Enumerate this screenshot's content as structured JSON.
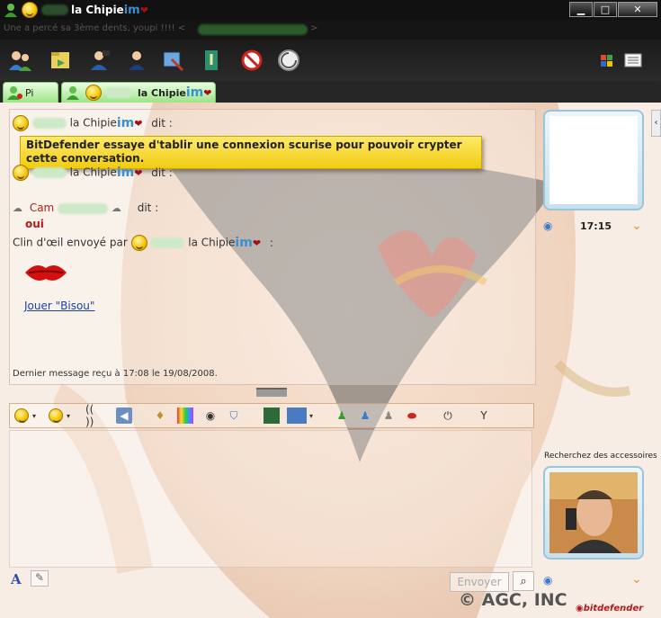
{
  "window": {
    "title_name": "la Chipie",
    "title_logo": "im",
    "personal_message": "Une a percé sa 3ème dents, youpi !!!! <",
    "personal_message_end": ">",
    "buttons": {
      "minimize": "▁",
      "maximize": "□",
      "close": "✕"
    }
  },
  "toolbar": {
    "icons": [
      "invite-contact-icon",
      "send-files-icon",
      "webcam-icon",
      "call-icon",
      "share-icon",
      "games-icon",
      "block-icon",
      "activities-icon"
    ]
  },
  "tabs": [
    {
      "label": "Pi"
    },
    {
      "label": "la Chipie",
      "logo": "im"
    }
  ],
  "notice": "BitDefender essaye d'tablir une connexion scurise pour pouvoir crypter cette conversation.",
  "conversation": {
    "msg1": {
      "name": "la Chipie",
      "logo": "im",
      "says": "dit :"
    },
    "msg2": {
      "name": "la Chipie",
      "logo": "im",
      "says": "dit :"
    },
    "msg3": {
      "name": "Cam",
      "says": "dit :",
      "text": "oui"
    },
    "wink": {
      "prefix": "Clin d'œil envoyé par",
      "name": "la Chipie",
      "logo": "im",
      "suffix": ":"
    },
    "play_link": "Jouer \"Bisou\"",
    "last_message": "Dernier message reçu à 17:08 le 19/08/2008."
  },
  "sidebar": {
    "time": "17:15",
    "accessories_label": "Recherchez des accessoires"
  },
  "input": {
    "send_label": "Envoyer"
  },
  "branding": {
    "copyright": "© AGC, INC",
    "bitdefender": "bitdefender"
  },
  "colors": {
    "notice_bg": "#f0cc10",
    "link": "#1a3fb0",
    "im_blue": "#3a8fd0",
    "im_red": "#a01010"
  }
}
